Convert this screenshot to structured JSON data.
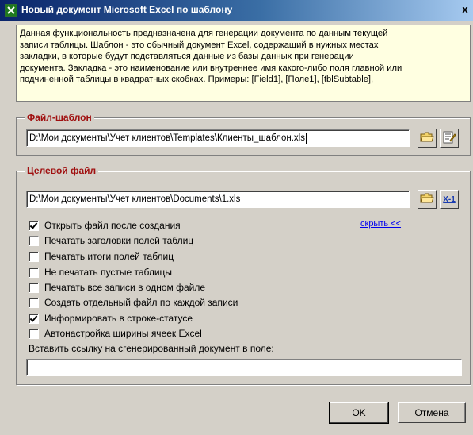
{
  "window": {
    "title": "Новый документ Microsoft Excel по шаблону",
    "close_glyph": "x"
  },
  "description": {
    "lines": [
      "Данная функциональность предназначена для генерации документа по данным текущей",
      "записи таблицы. Шаблон - это обычный документ Excel, содержащий в нужных местах",
      "закладки, в которые будут подставляться данные из базы данных при генерации",
      "документа. Закладка - это наименование или внутреннее имя какого-либо поля главной или",
      "подчиненной таблицы в квадратных скобках. Примеры: [Field1], [Поле1], [tblSubtable],"
    ]
  },
  "template_group": {
    "title": "Файл-шаблон",
    "path": "D:\\Мои документы\\Учет клиентов\\Templates\\Клиенты_шаблон.xls",
    "browse_icon": "open-folder-icon",
    "edit_icon": "edit-document-icon"
  },
  "target_group": {
    "title": "Целевой файл",
    "path": "D:\\Мои документы\\Учет клиентов\\Documents\\1.xls",
    "browse_icon": "open-folder-icon",
    "excel_icon": "excel-x1-icon",
    "excel_label": "X-1",
    "hide_link": "скрыть <<",
    "options": [
      {
        "label": "Открыть файл после создания",
        "checked": true
      },
      {
        "label": "Печатать заголовки полей таблиц",
        "checked": false
      },
      {
        "label": "Печатать итоги полей таблиц",
        "checked": false
      },
      {
        "label": "Не печатать пустые таблицы",
        "checked": false
      },
      {
        "label": "Печатать все записи в одном файле",
        "checked": false
      },
      {
        "label": "Создать отдельный файл по каждой записи",
        "checked": false
      },
      {
        "label": "Информировать в строке-статусе",
        "checked": true
      },
      {
        "label": "Автонастройка ширины ячеек Excel",
        "checked": false
      }
    ],
    "insert_link_label": "Вставить ссылку на сгенерированный документ в поле:",
    "insert_link_value": ""
  },
  "buttons": {
    "ok": "OK",
    "cancel": "Отмена"
  }
}
